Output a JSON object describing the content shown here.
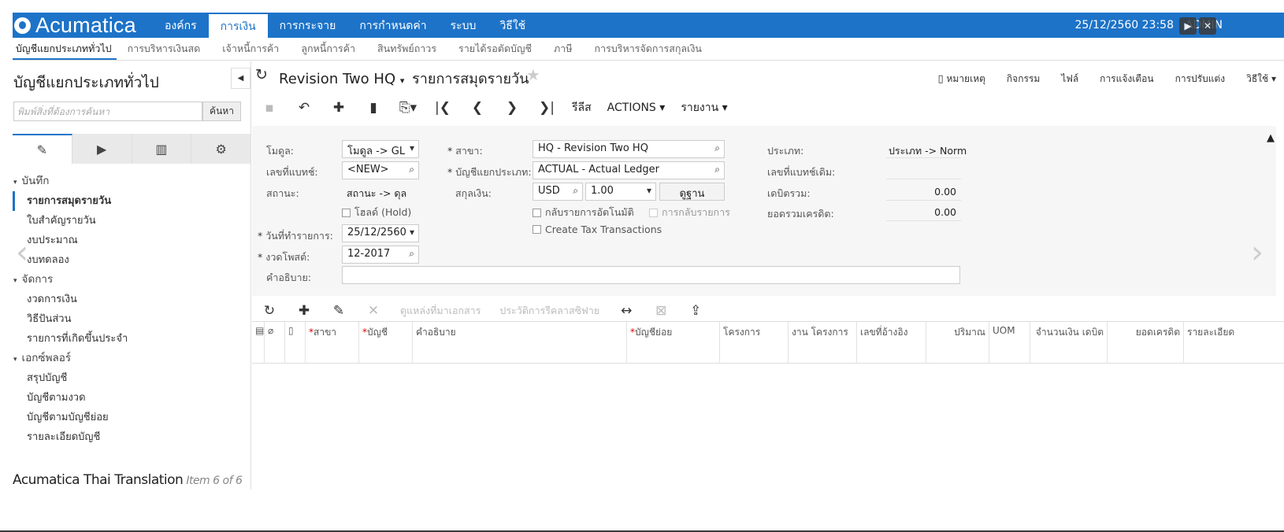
{
  "app": {
    "logo_text": "Acumatica"
  },
  "topmenu": [
    {
      "label": "องค์กร",
      "active": false
    },
    {
      "label": "การเงิน",
      "active": true
    },
    {
      "label": "การกระจาย",
      "active": false
    },
    {
      "label": "การกำหนดค่า",
      "active": false
    },
    {
      "label": "ระบบ",
      "active": false
    },
    {
      "label": "วิธีใช้",
      "active": false
    }
  ],
  "topbar": {
    "datetime": "25/12/2560  23:58",
    "user": "ADMIN"
  },
  "modules": [
    {
      "label": "บัญชีแยกประเภททั่วไป",
      "active": true
    },
    {
      "label": "การบริหารเงินสด"
    },
    {
      "label": "เจ้าหนี้การค้า"
    },
    {
      "label": "ลูกหนี้การค้า"
    },
    {
      "label": "สินทรัพย์ถาวร"
    },
    {
      "label": "รายได้รอตัดบัญชี"
    },
    {
      "label": "ภาษี"
    },
    {
      "label": "การบริหารจัดการสกุลเงิน"
    }
  ],
  "sidebar": {
    "title": "บัญชีแยกประเภททั่วไป",
    "search_placeholder": "พิมพ์สิ่งที่ต้องการค้นหา",
    "search_button": "ค้นหา",
    "groups": [
      {
        "label": "บันทึก",
        "items": [
          {
            "label": "รายการสมุดรายวัน",
            "active": true
          },
          {
            "label": "ใบสำคัญรายวัน"
          },
          {
            "label": "งบประมาณ"
          },
          {
            "label": "งบทดลอง"
          }
        ]
      },
      {
        "label": "จัดการ",
        "items": [
          {
            "label": "งวดการเงิน"
          },
          {
            "label": "วิธีปันส่วน"
          },
          {
            "label": "รายการที่เกิดขึ้นประจำ"
          }
        ]
      },
      {
        "label": "เอกซ์พลอร์",
        "items": [
          {
            "label": "สรุปบัญชี"
          },
          {
            "label": "บัญชีตามงวด"
          },
          {
            "label": "บัญชีตามบัญชีย่อย"
          },
          {
            "label": "รายละเอียดบัญชี"
          }
        ]
      }
    ]
  },
  "header": {
    "company": "Revision Two HQ",
    "screen_title": "รายการสมุดรายวัน",
    "links": [
      "หมายเหตุ",
      "กิจกรรม",
      "ไฟล์",
      "การแจ้งเตือน",
      "การปรับแต่ง",
      "วิธีใช้"
    ]
  },
  "toolbar": {
    "release": "รีลีส",
    "actions": "ACTIONS",
    "reports": "รายงาน"
  },
  "form": {
    "module_label": "โมดูล:",
    "module_value": "โมดูล -> GL",
    "batch_label": "เลขที่แบทช์:",
    "batch_value": "<NEW>",
    "status_label": "สถานะ:",
    "status_value": "สถานะ -> ดุล",
    "hold_label": "โฮลด์ (Hold)",
    "trandate_label": "วันที่ทำรายการ:",
    "trandate_value": "25/12/2560",
    "period_label": "งวดโพสต์:",
    "period_value": "12-2017",
    "desc_label": "คำอธิบาย:",
    "branch_label": "สาขา:",
    "branch_value": "HQ - Revision Two HQ",
    "ledger_label": "บัญชีแยกประเภท:",
    "ledger_value": "ACTUAL - Actual Ledger",
    "currency_label": "สกุลเงิน:",
    "currency_value": "USD",
    "rate_value": "1.00",
    "base_button": "ดูฐาน",
    "auto_reverse_label": "กลับรายการอัตโนมัติ",
    "reversing_label": "การกลับรายการ",
    "create_tax_label": "Create Tax Transactions",
    "type_label": "ประเภท:",
    "type_value": "ประเภท -> Norm",
    "orig_batch_label": "เลขที่แบทช์เดิม:",
    "debit_total_label": "เดบิตรวม:",
    "debit_total_value": "0.00",
    "credit_total_label": "ยอดรวมเครดิต:",
    "credit_total_value": "0.00"
  },
  "grid": {
    "toolbar": {
      "view_source": "ดูแหล่งที่มาเอกสาร",
      "reclass_history": "ประวัติการรีคลาสซิฟาย"
    },
    "columns": [
      "สาขา",
      "บัญชี",
      "คำอธิบาย",
      "บัญชีย่อย",
      "โครงการ",
      "งาน โครงการ",
      "เลขที่อ้างอิง",
      "ปริมาณ",
      "UOM",
      "จำนวนเงิน เดบิต",
      "ยอดเครดิต",
      "รายละเอียด"
    ]
  },
  "caption": {
    "title": "Acumatica Thai Translation",
    "item": "Item 6 of 6"
  }
}
